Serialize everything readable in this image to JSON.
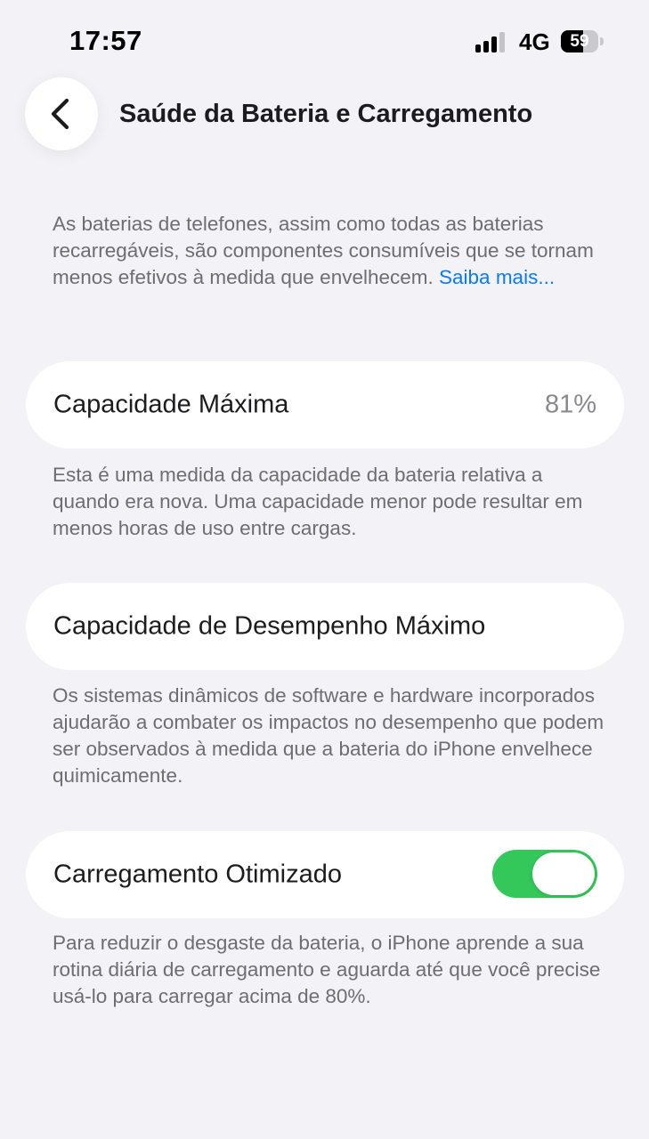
{
  "status_bar": {
    "time": "17:57",
    "network": "4G",
    "battery_percent": "59",
    "battery_level": 0.59,
    "signal_bars_active": 3,
    "signal_bars_total": 4
  },
  "header": {
    "back_icon": "chevron-left-icon",
    "title": "Saúde da Bateria e Carregamento"
  },
  "intro": {
    "text": "As baterias de telefones, assim como todas as baterias recarregáveis, são componentes consumíveis que se tornam menos efetivos à medida que envelhecem. ",
    "link": "Saiba mais..."
  },
  "max_capacity": {
    "label": "Capacidade Máxima",
    "value": "81%",
    "footer": "Esta é uma medida da capacidade da bateria relativa a quando era nova. Uma capacidade menor pode resultar em menos horas de uso entre cargas."
  },
  "peak_performance": {
    "label": "Capacidade de Desempenho Máximo",
    "footer": "Os sistemas dinâmicos de software e hardware incorporados ajudarão a combater os impactos no desempenho que podem ser observados à medida que a bateria do iPhone envelhece quimicamente."
  },
  "optimized_charging": {
    "label": "Carregamento Otimizado",
    "enabled": true,
    "footer": "Para reduzir o desgaste da bateria, o iPhone aprende a sua rotina diária de carregamento e aguarda até que você precise usá-lo para carregar acima de 80%."
  },
  "colors": {
    "background": "#f2f2f7",
    "link": "#0a7aff",
    "toggle_on": "#34c759",
    "secondary_text": "#6d6d72"
  }
}
